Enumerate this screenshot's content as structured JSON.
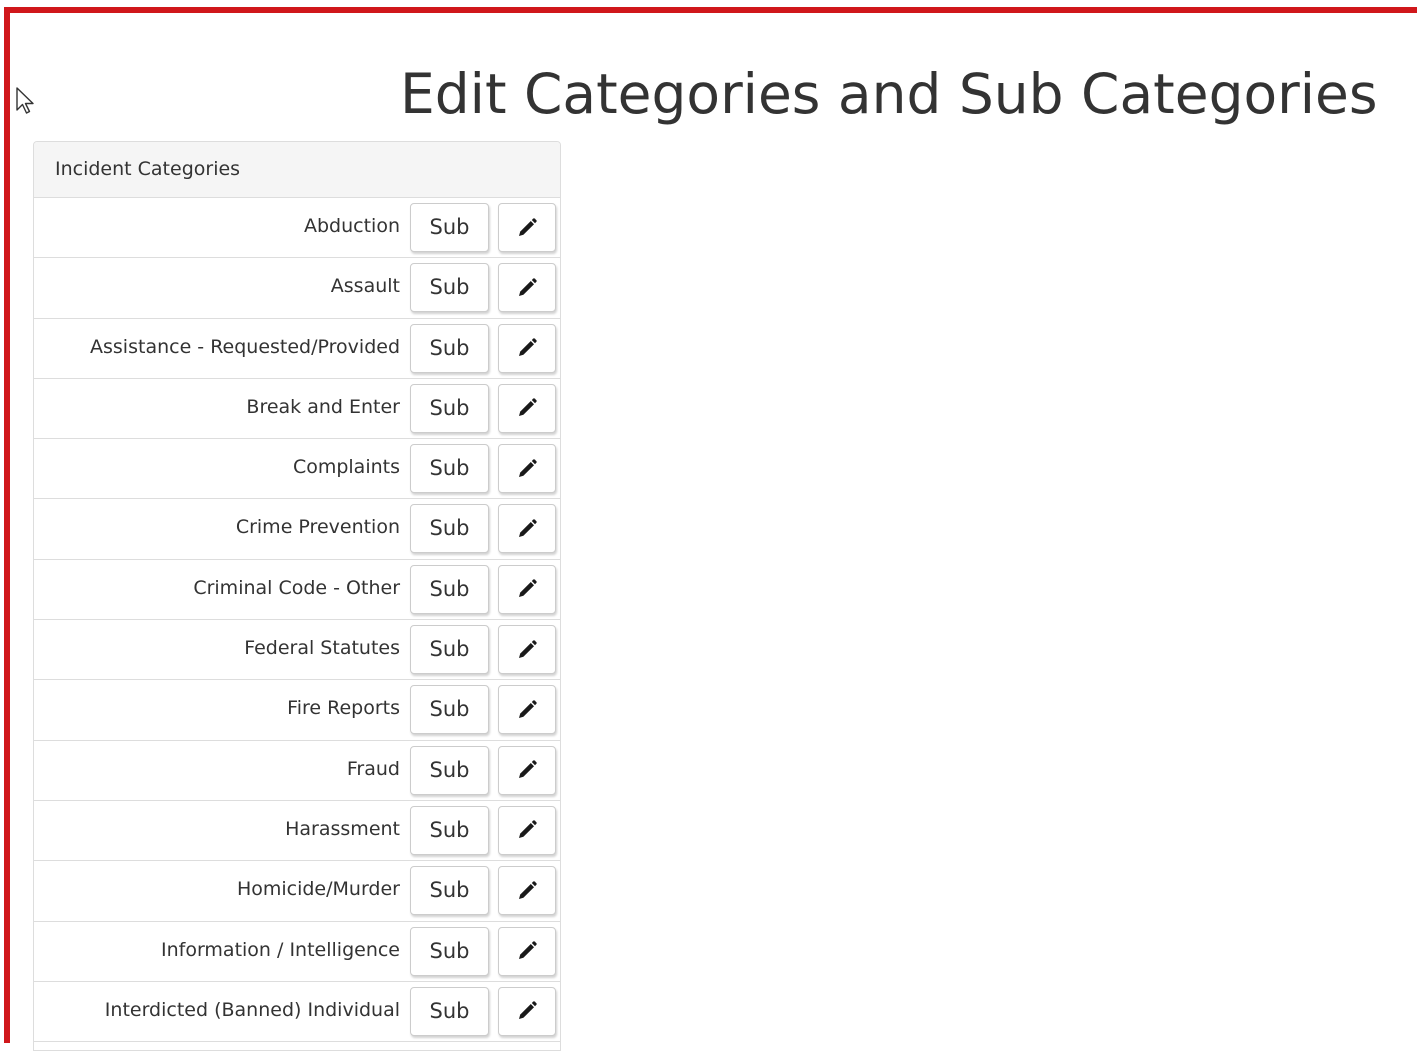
{
  "page": {
    "title": "Edit Categories and Sub Categories"
  },
  "panel": {
    "heading": "Incident Categories",
    "rows": [
      {
        "label": "Abduction",
        "sub_label": "Sub",
        "edit_icon": "pencil-icon"
      },
      {
        "label": "Assault",
        "sub_label": "Sub",
        "edit_icon": "pencil-icon"
      },
      {
        "label": "Assistance - Requested/Provided",
        "sub_label": "Sub",
        "edit_icon": "pencil-icon"
      },
      {
        "label": "Break and Enter",
        "sub_label": "Sub",
        "edit_icon": "pencil-icon"
      },
      {
        "label": "Complaints",
        "sub_label": "Sub",
        "edit_icon": "pencil-icon"
      },
      {
        "label": "Crime Prevention",
        "sub_label": "Sub",
        "edit_icon": "pencil-icon"
      },
      {
        "label": "Criminal Code - Other",
        "sub_label": "Sub",
        "edit_icon": "pencil-icon"
      },
      {
        "label": "Federal Statutes",
        "sub_label": "Sub",
        "edit_icon": "pencil-icon"
      },
      {
        "label": "Fire Reports",
        "sub_label": "Sub",
        "edit_icon": "pencil-icon"
      },
      {
        "label": "Fraud",
        "sub_label": "Sub",
        "edit_icon": "pencil-icon"
      },
      {
        "label": "Harassment",
        "sub_label": "Sub",
        "edit_icon": "pencil-icon"
      },
      {
        "label": "Homicide/Murder",
        "sub_label": "Sub",
        "edit_icon": "pencil-icon"
      },
      {
        "label": "Information / Intelligence",
        "sub_label": "Sub",
        "edit_icon": "pencil-icon"
      },
      {
        "label": "Interdicted (Banned) Individual",
        "sub_label": "Sub",
        "edit_icon": "pencil-icon"
      }
    ]
  },
  "colors": {
    "frame_border": "#d0171b",
    "panel_heading_bg": "#f5f5f5",
    "text": "#333333",
    "divider": "#dddddd"
  },
  "cursor_icon": "mouse-pointer-icon"
}
